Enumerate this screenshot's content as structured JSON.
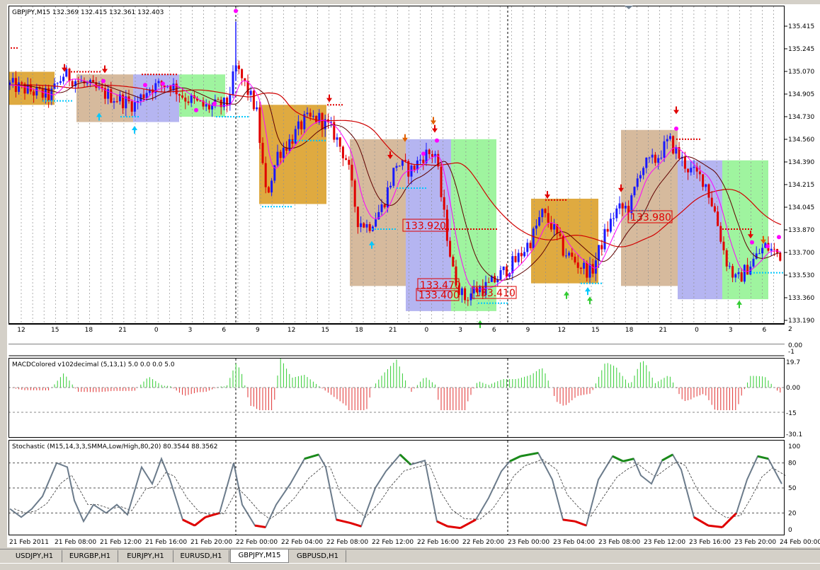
{
  "main_chart": {
    "header": "GBPJPY,M15  132.369 132.415 132.361 132.403",
    "price_axis": [
      "135.415",
      "135.245",
      "135.070",
      "134.905",
      "134.730",
      "134.560",
      "134.390",
      "134.215",
      "134.045",
      "133.870",
      "133.700",
      "133.530",
      "133.360",
      "133.190"
    ],
    "hour_ticks": [
      "12",
      "15",
      "18",
      "21",
      "0",
      "3",
      "6",
      "9",
      "12",
      "15",
      "18",
      "21",
      "0",
      "3",
      "6",
      "9",
      "12",
      "15",
      "18",
      "21",
      "0",
      "3",
      "6"
    ],
    "price_labels": [
      "133.920",
      "133.470",
      "133.400",
      "133.410",
      "133.980"
    ]
  },
  "macd": {
    "title": "MACDColored v102decimal (5,13,1) 5.0 0.0 0.0 5.0",
    "axis_top": [
      "2",
      "0.00",
      "-1"
    ],
    "axis": [
      "19.7",
      "0.00",
      "-15",
      "-30.1"
    ]
  },
  "stochastic": {
    "title": "Stochastic (M15,14,3,3,SMMA,Low/High,80,20) 80.3544 88.3562",
    "axis": [
      "100",
      "80",
      "50",
      "20",
      "0"
    ]
  },
  "time_axis": [
    "21 Feb 2011",
    "21 Feb 08:00",
    "21 Feb 12:00",
    "21 Feb 16:00",
    "21 Feb 20:00",
    "22 Feb 00:00",
    "22 Feb 04:00",
    "22 Feb 08:00",
    "22 Feb 12:00",
    "22 Feb 16:00",
    "22 Feb 20:00",
    "23 Feb 00:00",
    "23 Feb 04:00",
    "23 Feb 08:00",
    "23 Feb 12:00",
    "23 Feb 16:00",
    "23 Feb 20:00",
    "24 Feb 00:00"
  ],
  "tabs": [
    "USDJPY,H1",
    "EURGBP,H1",
    "EURJPY,H1",
    "EURUSD,H1",
    "GBPJPY,M15",
    "GBPUSD,H1"
  ],
  "active_tab": "GBPJPY,M15",
  "colors": {
    "up_candle": "#1a1aff",
    "down_candle": "#e00000",
    "box_orange": "#d99b1f",
    "box_tan": "#cfae8c",
    "box_lavender": "#a8a8ee",
    "box_green": "#8ef28e",
    "stoch_green": "#1a8a1a",
    "stoch_red": "#e00000",
    "stoch_line": "#6b7b8b",
    "magenta": "#ff00ff",
    "cyan": "#00c8ff"
  }
}
